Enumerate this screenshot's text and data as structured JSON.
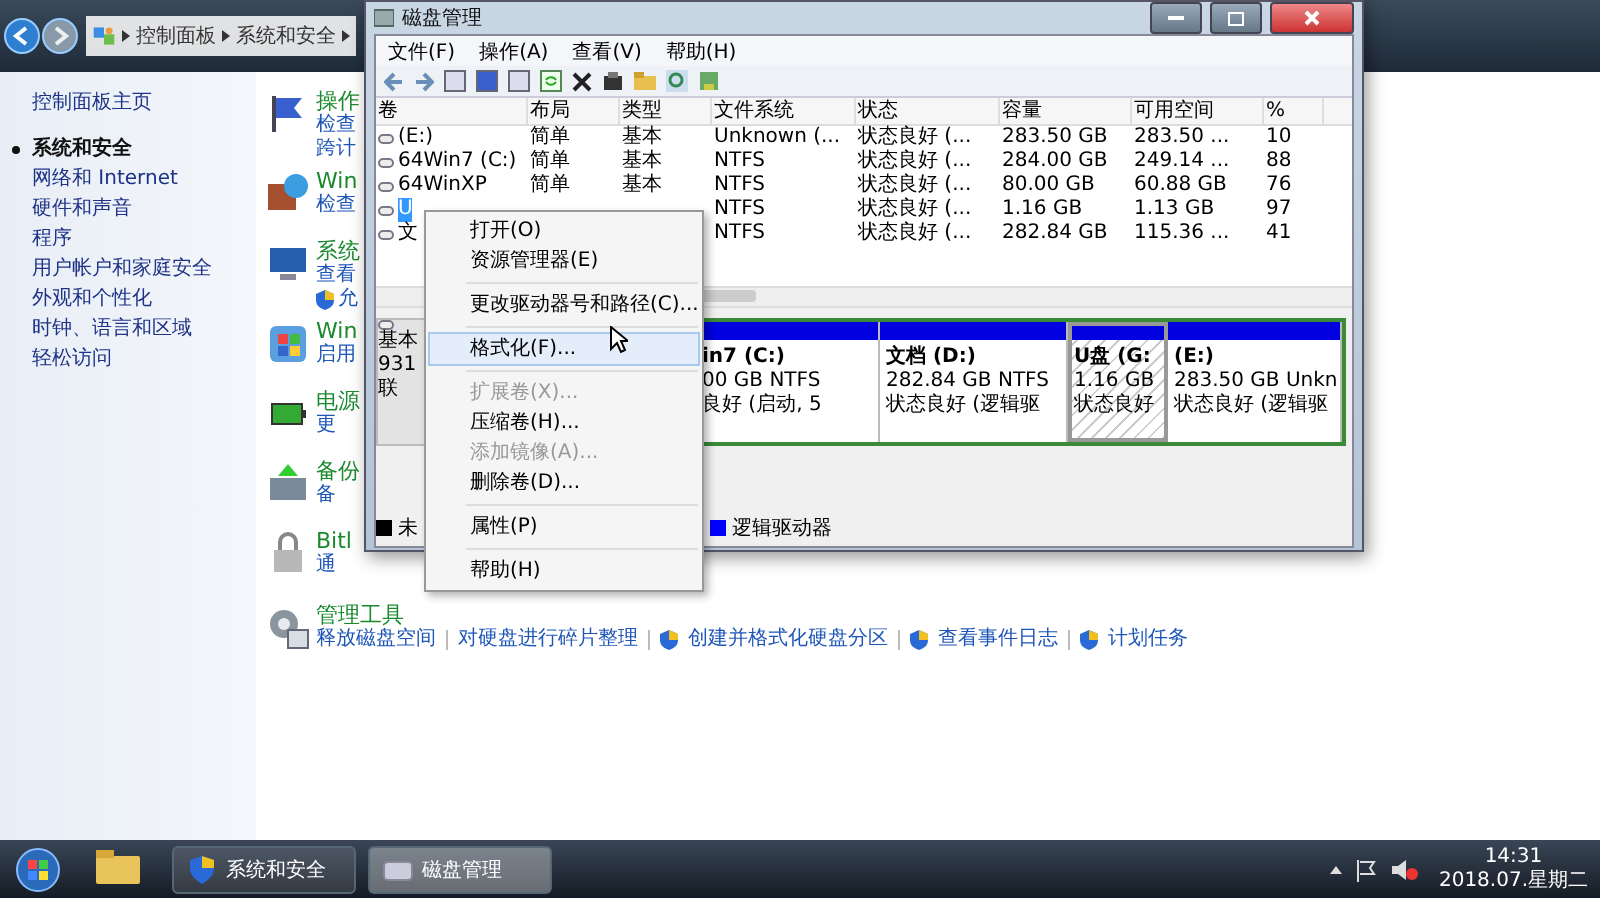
{
  "address": {
    "crumbs": [
      "控制面板",
      "系统和安全"
    ]
  },
  "nav": {
    "home": "控制面板主页",
    "items": [
      {
        "label": "系统和安全",
        "selected": true
      },
      {
        "label": "网络和 Internet",
        "selected": false
      },
      {
        "label": "硬件和声音",
        "selected": false
      },
      {
        "label": "程序",
        "selected": false
      },
      {
        "label": "用户帐户和家庭安全",
        "selected": false
      },
      {
        "label": "外观和个性化",
        "selected": false
      },
      {
        "label": "时钟、语言和区域",
        "selected": false
      },
      {
        "label": "轻松访问",
        "selected": false
      }
    ]
  },
  "categories": [
    {
      "title": "操作",
      "links": [
        {
          "label": "检查",
          "shield": false
        },
        {
          "label": "跨计",
          "shield": false
        }
      ]
    },
    {
      "title": "Win",
      "links": [
        {
          "label": "检查",
          "shield": false
        }
      ]
    },
    {
      "title": "系统",
      "links": [
        {
          "label": "查看",
          "shield": false
        },
        {
          "label": "允",
          "shield": true
        }
      ]
    },
    {
      "title": "Win",
      "links": [
        {
          "label": "启用",
          "shield": false
        }
      ]
    },
    {
      "title": "电源",
      "links": [
        {
          "label": "更",
          "shield": false
        }
      ]
    },
    {
      "title": "备份",
      "links": [
        {
          "label": "备",
          "shield": false
        }
      ]
    },
    {
      "title": "Bitl",
      "links": [
        {
          "label": "通",
          "shield": false
        }
      ]
    }
  ],
  "admin_tools": {
    "title": "管理工具",
    "links": [
      {
        "label": "释放磁盘空间",
        "shield": false
      },
      {
        "label": "对硬盘进行碎片整理",
        "shield": false
      },
      {
        "label": "创建并格式化硬盘分区",
        "shield": true
      },
      {
        "label": "查看事件日志",
        "shield": true
      },
      {
        "label": "计划任务",
        "shield": true
      }
    ]
  },
  "disk_window": {
    "title": "磁盘管理",
    "menu": [
      "文件(F)",
      "操作(A)",
      "查看(V)",
      "帮助(H)"
    ],
    "columns": [
      "卷",
      "布局",
      "类型",
      "文件系统",
      "状态",
      "容量",
      "可用空间",
      "%"
    ],
    "rows": [
      {
        "volume": "(E:)",
        "layout": "简单",
        "type": "基本",
        "fs": "Unknown (...",
        "status": "状态良好 (...",
        "capacity": "283.50 GB",
        "free": "283.50 ...",
        "percent": "10",
        "selected": false
      },
      {
        "volume": "64Win7  (C:)",
        "layout": "简单",
        "type": "基本",
        "fs": "NTFS",
        "status": "状态良好 (...",
        "capacity": "284.00 GB",
        "free": "249.14 ...",
        "percent": "88",
        "selected": false
      },
      {
        "volume": "64WinXP",
        "layout": "简单",
        "type": "基本",
        "fs": "NTFS",
        "status": "状态良好 (...",
        "capacity": "80.00 GB",
        "free": "60.88 GB",
        "percent": "76",
        "selected": false
      },
      {
        "volume": "U",
        "fs": "NTFS",
        "status": "状态良好 (...",
        "capacity": "1.16 GB",
        "free": "1.13 GB",
        "percent": "97",
        "selected": true
      },
      {
        "volume": "文",
        "fs": "NTFS",
        "status": "状态良好 (...",
        "capacity": "282.84 GB",
        "free": "115.36 ...",
        "percent": "41",
        "selected": false
      }
    ],
    "disk": {
      "labels": [
        "基本",
        "931",
        "联"
      ],
      "partitions": [
        {
          "name": "in7  (C:)",
          "size": "00 GB NTFS",
          "status": "良好 (启动, 5",
          "selected": false
        },
        {
          "name": "文档  (D:)",
          "size": "282.84 GB NTFS",
          "status": "状态良好 (逻辑驱",
          "selected": false
        },
        {
          "name": "U盘  (G:",
          "size": "1.16 GB",
          "status": "状态良好",
          "selected": true
        },
        {
          "name": "(E:)",
          "size": "283.50 GB Unkn",
          "status": "状态良好 (逻辑驱",
          "selected": false
        }
      ]
    },
    "legend": [
      {
        "label": "未",
        "color": "#000000"
      },
      {
        "label": "逻辑驱动器",
        "color": "#0000ff"
      }
    ]
  },
  "context_menu": {
    "items": [
      {
        "kind": "item",
        "label": "打开(O)",
        "disabled": false,
        "hovered": false
      },
      {
        "kind": "item",
        "label": "资源管理器(E)",
        "disabled": false,
        "hovered": false
      },
      {
        "kind": "separator"
      },
      {
        "kind": "item",
        "label": "更改驱动器号和路径(C)...",
        "disabled": false,
        "hovered": false
      },
      {
        "kind": "separator"
      },
      {
        "kind": "item",
        "label": "格式化(F)...",
        "disabled": false,
        "hovered": true
      },
      {
        "kind": "separator"
      },
      {
        "kind": "item",
        "label": "扩展卷(X)...",
        "disabled": true,
        "hovered": false
      },
      {
        "kind": "item",
        "label": "压缩卷(H)...",
        "disabled": false,
        "hovered": false
      },
      {
        "kind": "item",
        "label": "添加镜像(A)...",
        "disabled": true,
        "hovered": false
      },
      {
        "kind": "item",
        "label": "删除卷(D)...",
        "disabled": false,
        "hovered": false
      },
      {
        "kind": "separator"
      },
      {
        "kind": "item",
        "label": "属性(P)",
        "disabled": false,
        "hovered": false
      },
      {
        "kind": "separator"
      },
      {
        "kind": "item",
        "label": "帮助(H)",
        "disabled": false,
        "hovered": false
      }
    ]
  },
  "taskbar": {
    "tasks": [
      {
        "label": "系统和安全",
        "active": false
      },
      {
        "label": "磁盘管理",
        "active": true
      }
    ],
    "time": "14:31",
    "date": "2018.07.星期二"
  }
}
